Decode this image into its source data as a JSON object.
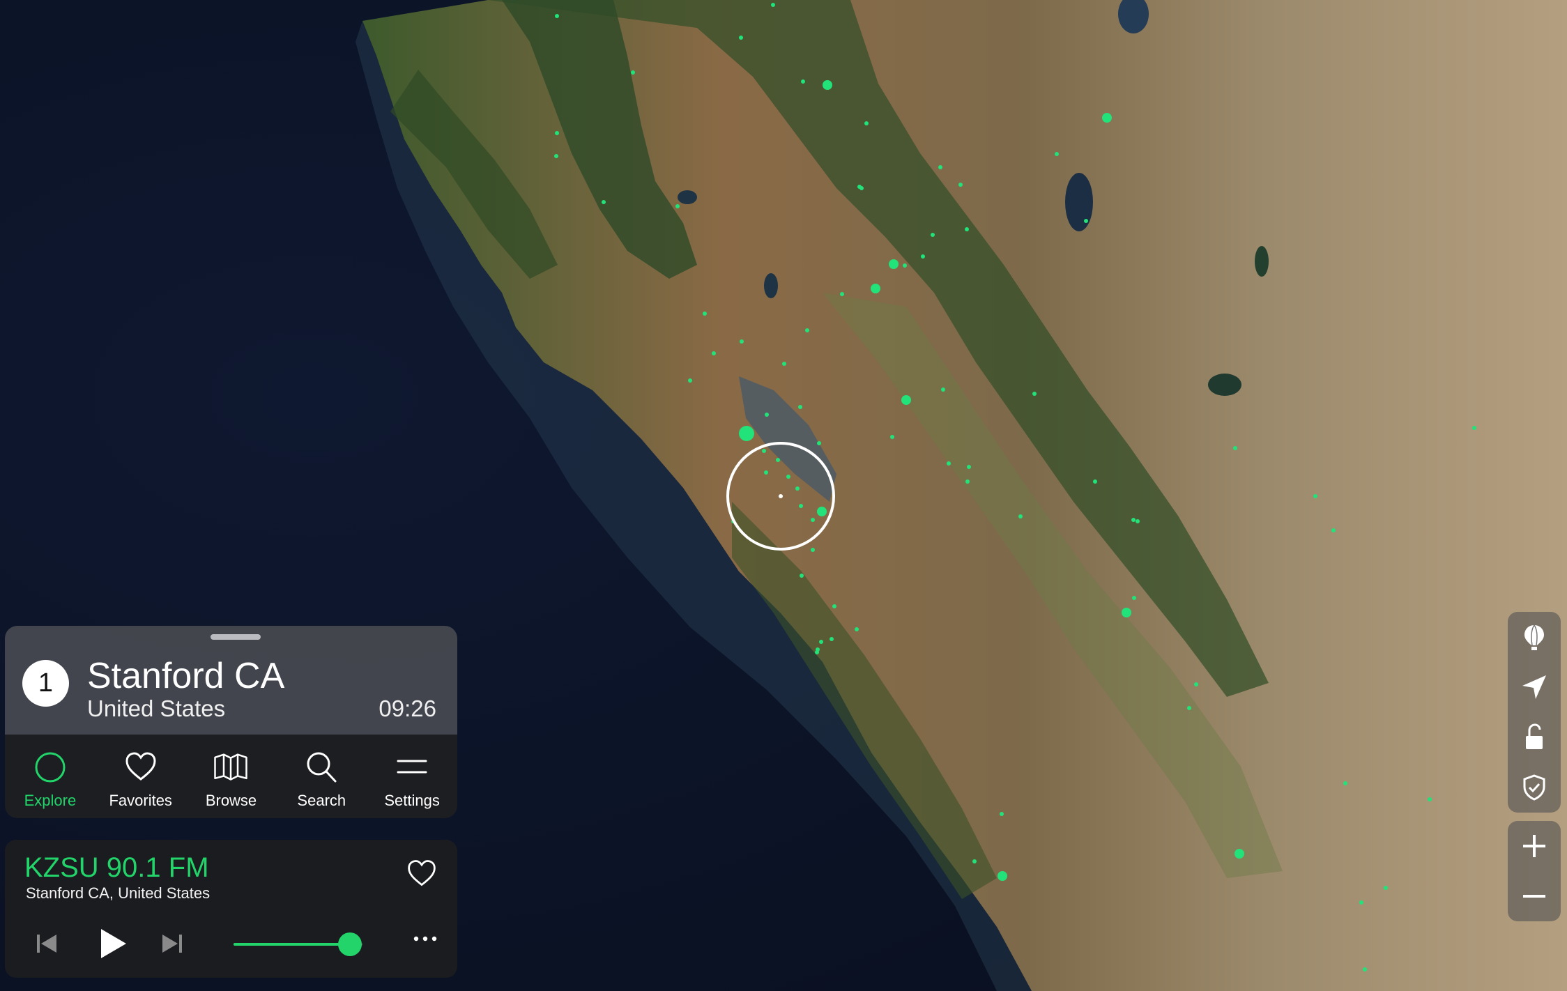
{
  "accent_color": "#22d46a",
  "location": {
    "rank": "1",
    "name": "Stanford CA",
    "country": "United States",
    "local_time": "09:26"
  },
  "nav": [
    {
      "label": "Explore",
      "icon": "explore-circle-icon",
      "active": true
    },
    {
      "label": "Favorites",
      "icon": "heart-icon",
      "active": false
    },
    {
      "label": "Browse",
      "icon": "map-icon",
      "active": false
    },
    {
      "label": "Search",
      "icon": "search-icon",
      "active": false
    },
    {
      "label": "Settings",
      "icon": "menu-icon",
      "active": false
    }
  ],
  "player": {
    "station": "KZSU 90.1 FM",
    "location": "Stanford CA, United States",
    "volume": 0.9
  },
  "map_controls": [
    "balloon-icon",
    "location-arrow-icon",
    "unlock-icon",
    "shield-icon",
    "zoom-in-icon",
    "zoom-out-icon"
  ]
}
